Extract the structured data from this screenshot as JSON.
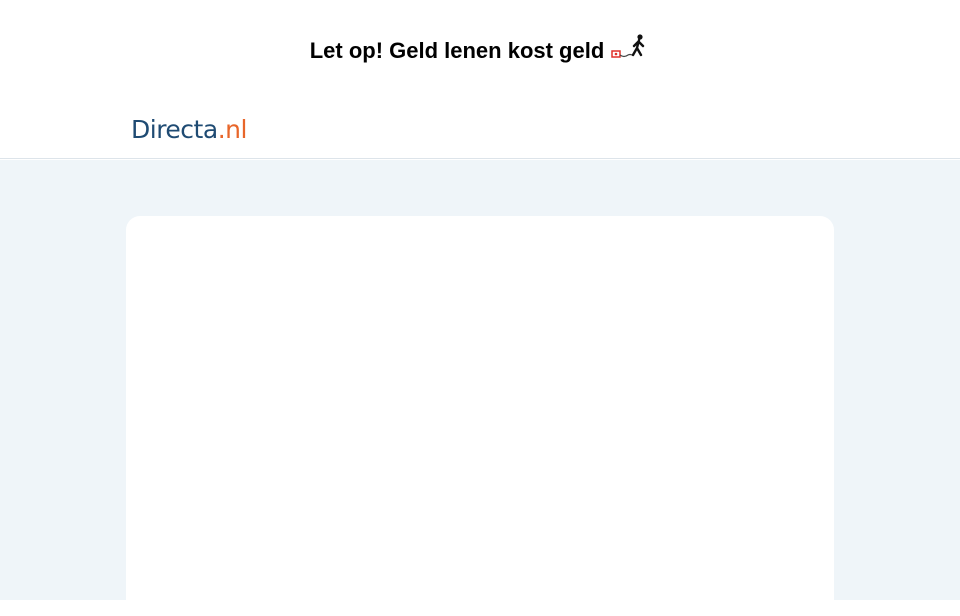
{
  "warning": {
    "text": "Let op! Geld lenen kost geld",
    "icon": "walking-man-with-money-icon"
  },
  "header": {
    "logo_brand": "Directa",
    "logo_tld": ".nl",
    "brand_color": "#1f4b73",
    "accent_color": "#e8662a"
  },
  "main": {
    "background_color": "#eff5f9"
  }
}
